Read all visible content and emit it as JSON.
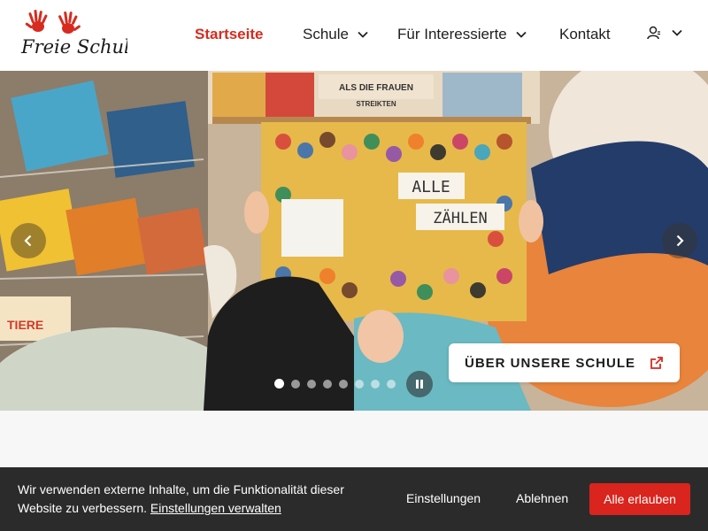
{
  "logo": {
    "text": "Freie Schule",
    "colors": {
      "hands": "#d72b1f",
      "text": "#1a1a1a"
    }
  },
  "nav": {
    "items": [
      {
        "label": "Startseite",
        "active": true
      },
      {
        "label": "Schule",
        "has_dropdown": true
      },
      {
        "label": "Für Interessierte",
        "has_dropdown": true
      },
      {
        "label": "Kontakt"
      }
    ],
    "user_icon": "user-icon"
  },
  "hero": {
    "book_title_line1": "ALLE",
    "book_title_line2": "ZÄHLEN",
    "shelf_sign": "ALS DIE FRAUEN",
    "shelf_sign2": "STREIKTEN",
    "book_tiere": "TIERE",
    "cta_label": "ÜBER UNSERE SCHULE",
    "cta_icon": "external-link-icon",
    "slides_count": 8,
    "active_slide": 1,
    "prev_icon": "chevron-left-icon",
    "next_icon": "chevron-right-icon",
    "pause_icon": "pause-icon"
  },
  "cookie": {
    "text": "Wir verwenden externe Inhalte, um die Funktionalität dieser Website zu verbessern.",
    "manage_link": "Einstellungen verwalten",
    "settings_label": "Einstellungen",
    "decline_label": "Ablehnen",
    "accept_label": "Alle erlauben"
  },
  "colors": {
    "accent": "#d72b1f",
    "cookie_bg": "#2c2b2c",
    "accept_bg": "#d9251d"
  }
}
